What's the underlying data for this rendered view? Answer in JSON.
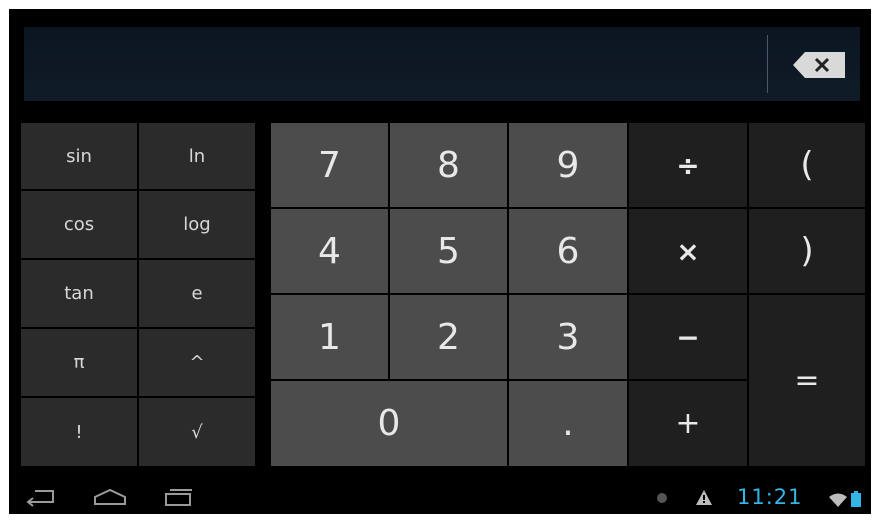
{
  "display": {
    "expression": ""
  },
  "scientific_keys": [
    [
      "sin",
      "ln"
    ],
    [
      "cos",
      "log"
    ],
    [
      "tan",
      "e"
    ],
    [
      "π",
      "^"
    ],
    [
      "!",
      "√"
    ]
  ],
  "digits": {
    "seven": "7",
    "eight": "8",
    "nine": "9",
    "four": "4",
    "five": "5",
    "six": "6",
    "one": "1",
    "two": "2",
    "three": "3",
    "zero": "0",
    "point": "."
  },
  "operators": {
    "divide": "÷",
    "multiply": "×",
    "minus": "−",
    "plus": "+",
    "open_paren": "(",
    "close_paren": ")",
    "equals": "="
  },
  "status_bar": {
    "time": "11:21"
  },
  "icons": {
    "backspace": "backspace-icon",
    "back": "back-icon",
    "home": "home-icon",
    "recents": "recent-apps-icon",
    "notification": "notification-dot-icon",
    "warning": "warning-icon",
    "wifi": "wifi-icon",
    "battery": "battery-icon"
  },
  "colors": {
    "clock": "#33b5e5",
    "digit_key": "#4c4c4c",
    "sci_key": "#2b2b2b",
    "op_key": "#1f1f1f"
  }
}
